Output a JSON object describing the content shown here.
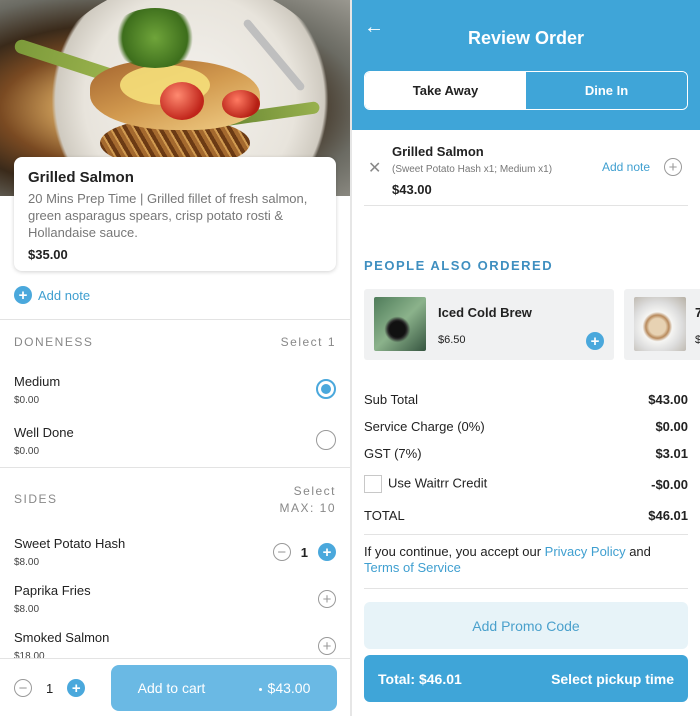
{
  "colors": {
    "accent": "#3fa5d8",
    "accent_light": "#6ab9e4",
    "link": "#3f9fd0",
    "promo_bg": "#e7f3f8"
  },
  "item_detail": {
    "name": "Grilled Salmon",
    "description": "20 Mins Prep Time | Grilled fillet of fresh salmon, green asparagus spears, crisp potato rosti & Hollandaise sauce.",
    "price": "$35.00",
    "add_note": "Add note"
  },
  "doneness": {
    "title": "DONENESS",
    "hint": "Select 1",
    "options": [
      {
        "name": "Medium",
        "price": "$0.00",
        "selected": true
      },
      {
        "name": "Well Done",
        "price": "$0.00",
        "selected": false
      }
    ]
  },
  "sides": {
    "title": "SIDES",
    "hint_line1": "Select",
    "hint_line2": "MAX: 10",
    "options": [
      {
        "name": "Sweet Potato Hash",
        "price": "$8.00",
        "qty": "1"
      },
      {
        "name": "Paprika Fries",
        "price": "$8.00"
      },
      {
        "name": "Smoked Salmon",
        "price": "$18.00"
      }
    ]
  },
  "cart_bar": {
    "qty": "1",
    "button_label": "Add to cart",
    "button_total": "$43.00"
  },
  "review": {
    "title": "Review Order",
    "tabs": [
      "Take Away",
      "Dine In"
    ],
    "active_tab": "Take Away",
    "order_item": {
      "name": "Grilled Salmon",
      "modifiers": "(Sweet Potato Hash x1; Medium x1)",
      "price": "$43.00",
      "add_note": "Add note"
    },
    "people_also_ordered": {
      "title": "PEOPLE ALSO ORDERED",
      "items": [
        {
          "name": "Iced Cold Brew",
          "price": "$6.50"
        },
        {
          "name": "7",
          "price": "$"
        }
      ]
    },
    "summary": {
      "sub_total_label": "Sub Total",
      "sub_total": "$43.00",
      "service_label": "Service Charge (0%)",
      "service": "$0.00",
      "gst_label": "GST (7%)",
      "gst": "$3.01",
      "credit_label": "Use Waitrr Credit",
      "credit": "-$0.00",
      "total_label": "TOTAL",
      "total": "$46.01"
    },
    "policy": {
      "prefix": "If you continue, you accept our ",
      "privacy": "Privacy Policy",
      "and": " and ",
      "terms": "Terms of Service"
    },
    "promo_label": "Add Promo Code",
    "footer": {
      "total": "Total: $46.01",
      "action": "Select pickup time"
    }
  },
  "icons": {
    "back": "back-arrow-icon",
    "remove": "close-icon",
    "add": "plus-circle-icon",
    "minus": "minus-circle-icon"
  }
}
